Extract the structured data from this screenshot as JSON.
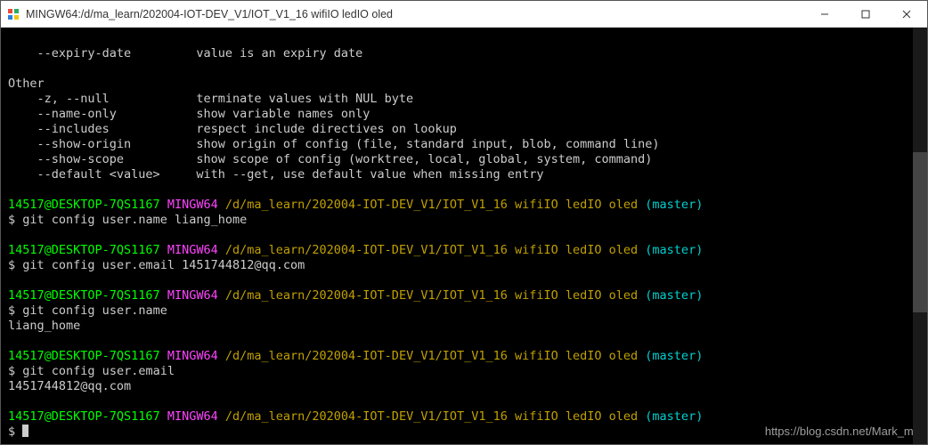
{
  "window": {
    "title": "MINGW64:/d/ma_learn/202004-IOT-DEV_V1/IOT_V1_16 wifiIO ledIO oled"
  },
  "help": {
    "opt_expiry": "    --expiry-date         value is an expiry date",
    "blank1": "",
    "other_hdr": "Other",
    "opt_null": "    -z, --null            terminate values with NUL byte",
    "opt_name": "    --name-only           show variable names only",
    "opt_incl": "    --includes            respect include directives on lookup",
    "opt_orig": "    --show-origin         show origin of config (file, standard input, blob, command line)",
    "opt_scope": "    --show-scope          show scope of config (worktree, local, global, system, command)",
    "opt_default": "    --default <value>     with --get, use default value when missing entry"
  },
  "prompt": {
    "userhost": "14517@DESKTOP-7QS1167",
    "shell": "MINGW64",
    "path": "/d/ma_learn/202004-IOT-DEV_V1/IOT_V1_16 wifiIO ledIO oled",
    "branch": "(master)",
    "ps1": "$"
  },
  "cmds": {
    "c1": "git config user.name liang_home",
    "c2": "git config user.email 1451744812@qq.com",
    "c3": "git config user.name",
    "out3": "liang_home",
    "c4": "git config user.email",
    "out4": "1451744812@qq.com",
    "c5": ""
  },
  "watermark": "https://blog.csdn.net/Mark_md"
}
